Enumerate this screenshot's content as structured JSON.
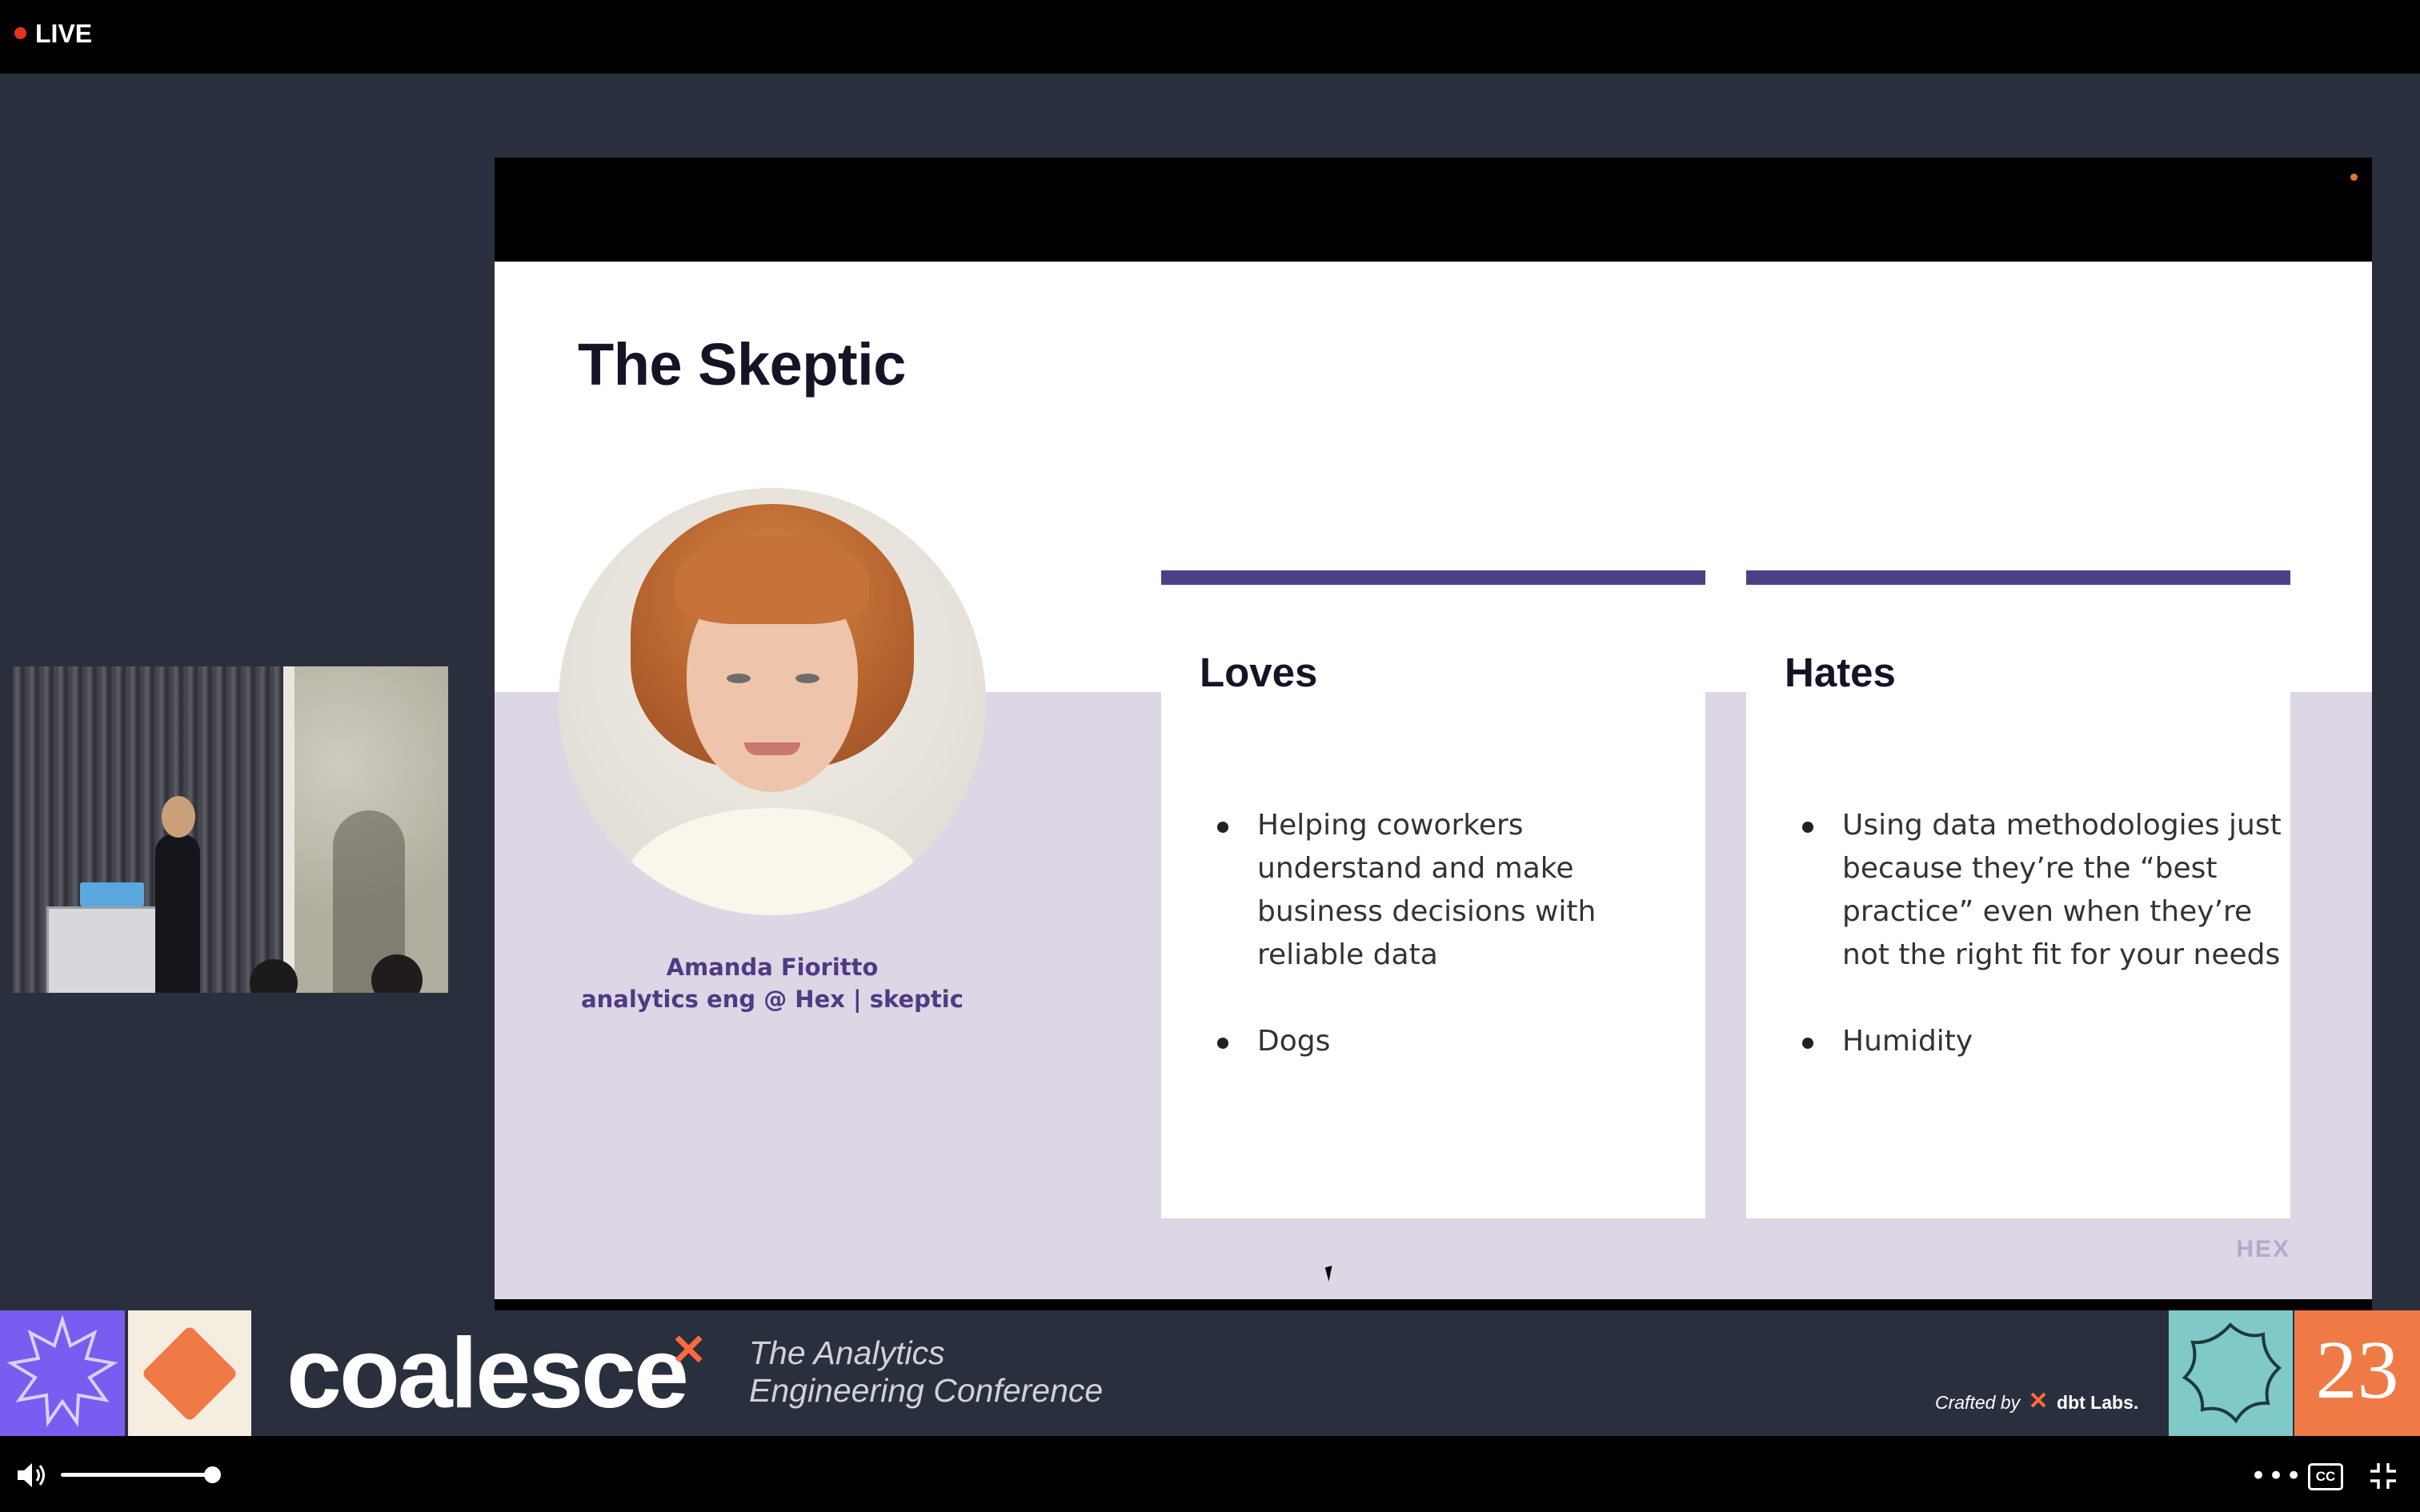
{
  "topbar": {
    "live_label": "LIVE",
    "live_color": "#e8321d"
  },
  "slide": {
    "title": "The Skeptic",
    "person_name": "Amanda Fioritto",
    "person_role": "analytics eng @ Hex | skeptic",
    "accent_color": "#4e3f86",
    "lower_bg_color": "#ddd6e4",
    "loves": {
      "heading": "Loves",
      "items": [
        "Helping coworkers understand and make business decisions with reliable data",
        "Dogs"
      ]
    },
    "hates": {
      "heading": "Hates",
      "items": [
        "Using data methodologies just because they’re the “best practice” even when they’re not the right fit for your needs",
        "Humidity"
      ]
    },
    "logo_text": "HEX"
  },
  "banner": {
    "brand_name": "coalesce",
    "brand_mark": "✕",
    "tagline_line1": "The Analytics",
    "tagline_line2": "Engineering Conference",
    "crafted_by": "Crafted by",
    "crafted_brand": "dbt Labs.",
    "year": "23",
    "tile_colors": [
      "#7a5cf0",
      "#f5ede0",
      "#7fc9c9",
      "#f07a46"
    ]
  },
  "player": {
    "volume_level": 0.7,
    "icons": [
      "volume-icon",
      "more-icon",
      "cc-icon",
      "exit-fullscreen-icon"
    ],
    "cc_label": "CC"
  }
}
